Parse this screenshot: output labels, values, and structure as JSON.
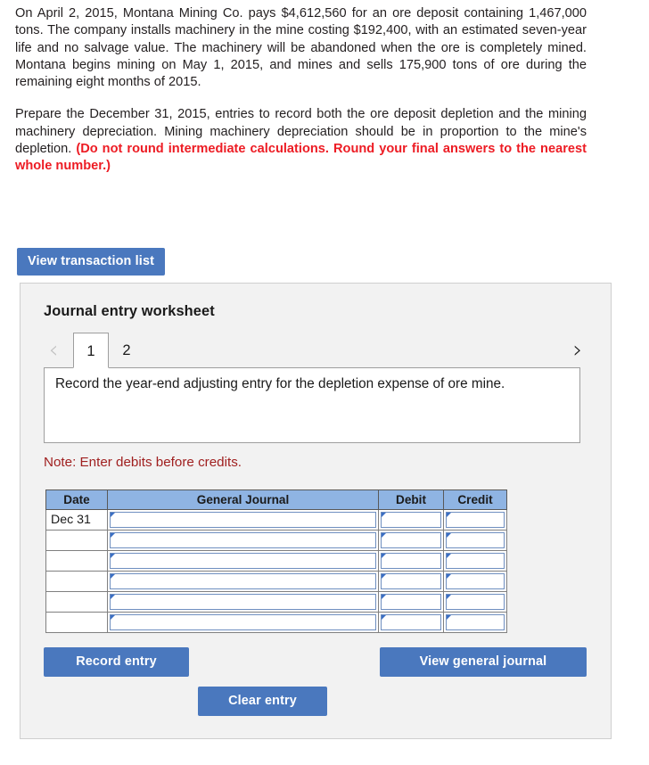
{
  "problem": {
    "paragraph_1": "On April 2, 2015, Montana Mining Co. pays $4,612,560 for an ore deposit containing 1,467,000 tons. The company installs machinery in the mine costing $192,400, with an estimated seven-year life and no salvage value. The machinery will be abandoned when the ore is completely mined. Montana begins mining on May 1, 2015, and mines and sells 175,900 tons of ore during the remaining eight months of 2015.",
    "paragraph_2_plain": "Prepare the December 31, 2015, entries to record both the ore deposit depletion and the mining machinery depreciation. Mining machinery depreciation should be in proportion to the mine's depletion. ",
    "paragraph_2_emphasis": "(Do not round intermediate calculations. Round your final answers to the nearest whole number.)"
  },
  "toolbar": {
    "view_transaction_list_label": "View transaction list"
  },
  "worksheet": {
    "title": "Journal entry worksheet",
    "nav": {
      "prev_icon": "‹",
      "next_icon": "›"
    },
    "tabs": [
      {
        "label": "1",
        "active": true
      },
      {
        "label": "2",
        "active": false
      }
    ],
    "instruction": "Record the year-end adjusting entry for the depletion expense of ore mine.",
    "note": "Note: Enter debits before credits.",
    "table": {
      "headers": [
        "Date",
        "General Journal",
        "Debit",
        "Credit"
      ],
      "rows": [
        {
          "date": "Dec 31",
          "general_journal": "",
          "debit": "",
          "credit": ""
        },
        {
          "date": "",
          "general_journal": "",
          "debit": "",
          "credit": ""
        },
        {
          "date": "",
          "general_journal": "",
          "debit": "",
          "credit": ""
        },
        {
          "date": "",
          "general_journal": "",
          "debit": "",
          "credit": ""
        },
        {
          "date": "",
          "general_journal": "",
          "debit": "",
          "credit": ""
        },
        {
          "date": "",
          "general_journal": "",
          "debit": "",
          "credit": ""
        }
      ]
    },
    "buttons": {
      "record_entry_label": "Record entry",
      "clear_entry_label": "Clear entry",
      "view_general_journal_label": "View general journal"
    }
  },
  "colors": {
    "button_blue": "#4a78be",
    "table_header_blue": "#8fb4e3",
    "emphasis_red": "#ed1c24",
    "note_red": "#a02020",
    "panel_bg": "#f2f2f2"
  }
}
